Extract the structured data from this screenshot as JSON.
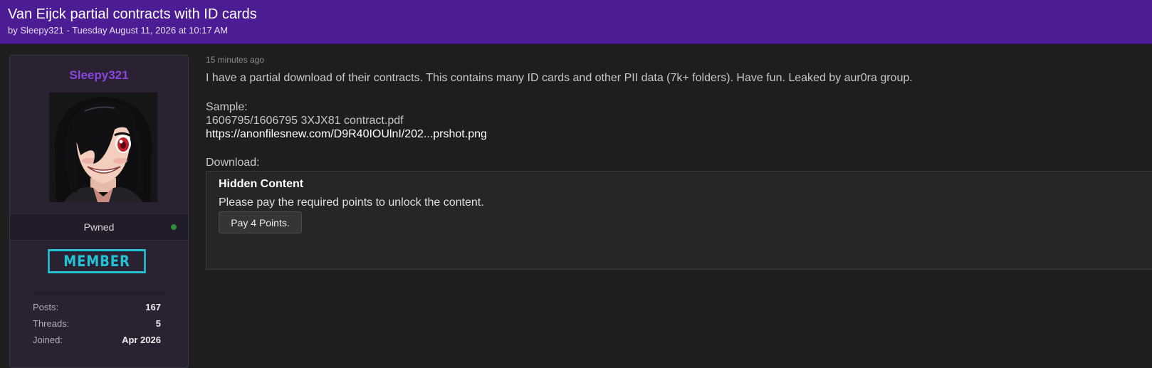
{
  "thread": {
    "title": "Van Eijck partial contracts with ID cards",
    "byline": "by Sleepy321 - Tuesday August 11, 2026 at 10:17 AM"
  },
  "user": {
    "username": "Sleepy321",
    "title": "Pwned",
    "online_status": "online",
    "rank": "MEMBER",
    "avatar_icon": "anime-avatar-icon",
    "stats": [
      {
        "label": "Posts:",
        "value": "167"
      },
      {
        "label": "Threads:",
        "value": "5"
      },
      {
        "label": "Joined:",
        "value": "Apr 2026"
      }
    ]
  },
  "post": {
    "time": "15 minutes ago",
    "body": "I have a partial download of their contracts. This contains many ID cards and other PII data (7k+ folders). Have fun. Leaked by aur0ra group.",
    "sample_label": "Sample:",
    "sample_file": "1606795/1606795 3XJX81 contract.pdf",
    "sample_link": "https://anonfilesnew.com/D9R40IOUlnI/202...prshot.png",
    "download_label": "Download:",
    "hidden": {
      "title": "Hidden Content",
      "message": "Please pay the required points to unlock the content.",
      "button": "Pay 4 Points."
    }
  },
  "colors": {
    "header_bg": "#4c1c94",
    "username": "#8a44e0",
    "rank_badge": "#22c3d3",
    "page_bg": "#1e1e1e"
  }
}
